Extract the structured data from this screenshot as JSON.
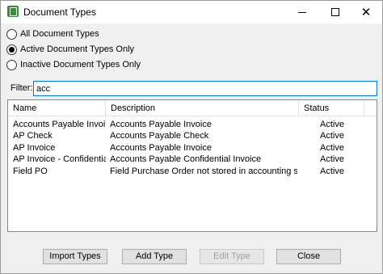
{
  "window": {
    "title": "Document Types"
  },
  "filters": {
    "options": [
      {
        "label": "All Document Types",
        "checked": false
      },
      {
        "label": "Active Document Types Only",
        "checked": true
      },
      {
        "label": "Inactive Document Types Only",
        "checked": false
      }
    ]
  },
  "filter": {
    "label": "Filter:",
    "value": "acc"
  },
  "list": {
    "columns": [
      "Name",
      "Description",
      "Status"
    ],
    "rows": [
      {
        "name": "Accounts Payable Invoice",
        "description": "Accounts Payable Invoice",
        "status": "Active"
      },
      {
        "name": "AP Check",
        "description": "Accounts Payable Check",
        "status": "Active"
      },
      {
        "name": "AP Invoice",
        "description": "Accounts Payable Invoice",
        "status": "Active"
      },
      {
        "name": "AP Invoice - Confidential",
        "description": "Accounts Payable Confidential Invoice",
        "status": "Active"
      },
      {
        "name": "Field PO",
        "description": "Field Purchase Order not stored in accounting system",
        "status": "Active"
      }
    ]
  },
  "buttons": {
    "import": "Import Types",
    "add": "Add Type",
    "edit": "Edit Type",
    "close": "Close"
  },
  "icons": {
    "app": "document-types-app-icon",
    "minimize": "minimize-icon",
    "maximize": "maximize-icon",
    "close": "close-icon"
  }
}
